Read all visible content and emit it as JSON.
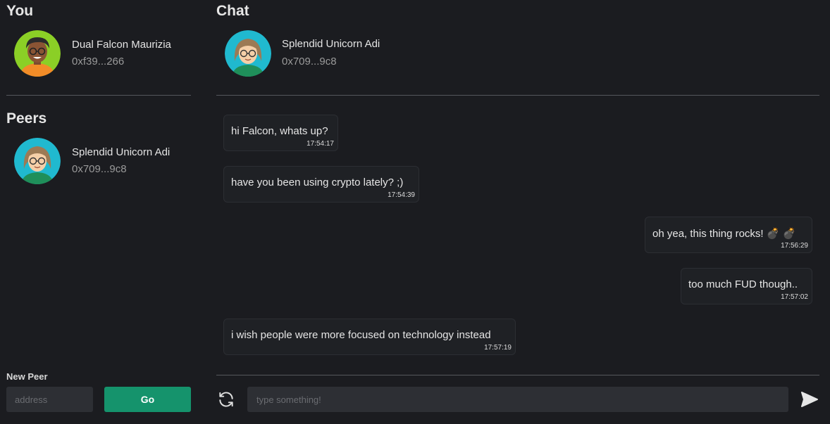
{
  "you": {
    "title": "You",
    "user": {
      "name": "Dual Falcon Maurizia",
      "address": "0xf39...266",
      "avatar_icon": "avatar-falcon-icon"
    }
  },
  "peers": {
    "title": "Peers",
    "items": [
      {
        "name": "Splendid Unicorn Adi",
        "address": "0x709...9c8",
        "avatar_icon": "avatar-unicorn-icon"
      }
    ]
  },
  "new_peer": {
    "label": "New Peer",
    "placeholder": "address",
    "button_label": "Go"
  },
  "chat": {
    "title": "Chat",
    "peer": {
      "name": "Splendid Unicorn Adi",
      "address": "0x709...9c8"
    },
    "messages": [
      {
        "text": "hi Falcon, whats up?",
        "time": "17:54:17",
        "from": "peer"
      },
      {
        "text": "have you been using crypto lately? ;)",
        "time": "17:54:39",
        "from": "peer"
      },
      {
        "text": "oh yea, this thing rocks! 💣 💣",
        "time": "17:56:29",
        "from": "you"
      },
      {
        "text": "too much FUD though..",
        "time": "17:57:02",
        "from": "you"
      },
      {
        "text": "i wish people were more focused on technology instead",
        "time": "17:57:19",
        "from": "peer"
      }
    ],
    "input_placeholder": "type something!"
  },
  "colors": {
    "background": "#1b1c20",
    "accent": "#15936c",
    "input_bg": "#2d2f34",
    "divider": "#55575c"
  }
}
